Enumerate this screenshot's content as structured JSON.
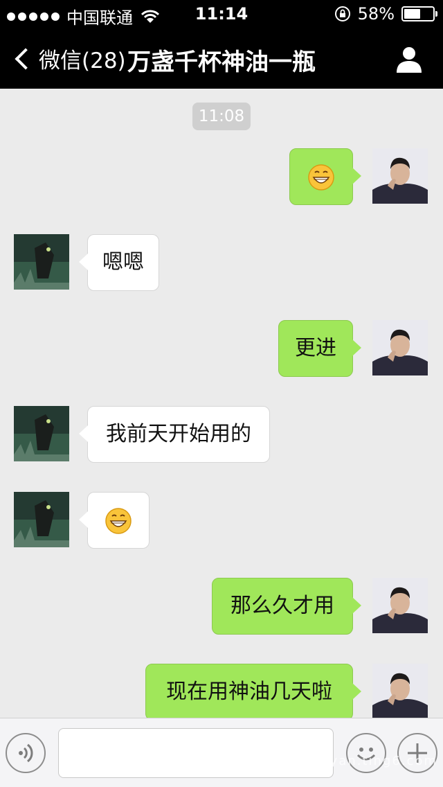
{
  "status_bar": {
    "carrier": "中国联通",
    "time": "11:14",
    "battery_text": "58%",
    "battery_level": 0.58,
    "icons": [
      "signal-dots-icon",
      "wifi-icon",
      "orientation-lock-icon",
      "battery-icon"
    ]
  },
  "nav": {
    "back_label": "微信(28)",
    "title": "万盏千杯神油一瓶",
    "right_icon": "person-icon"
  },
  "chat": {
    "timestamp": "11:08",
    "messages": [
      {
        "from": "me",
        "type": "emoji",
        "text": "",
        "icon": "grinning-face-emoji"
      },
      {
        "from": "them",
        "type": "text",
        "text": "嗯嗯"
      },
      {
        "from": "me",
        "type": "text",
        "text": "更进"
      },
      {
        "from": "them",
        "type": "text",
        "text": "我前天开始用的"
      },
      {
        "from": "them",
        "type": "emoji",
        "text": "",
        "icon": "grinning-face-emoji"
      },
      {
        "from": "me",
        "type": "text",
        "text": "那么久才用"
      },
      {
        "from": "me",
        "type": "text",
        "text": "现在用神油几天啦"
      }
    ]
  },
  "input_bar": {
    "voice_icon": "voice-icon",
    "input_value": "",
    "emoji_icon": "smiley-icon",
    "plus_icon": "plus-icon"
  },
  "colors": {
    "nav_bg": "#000000",
    "chat_bg": "#ebebeb",
    "my_bubble": "#a0e75a",
    "their_bubble": "#ffffff"
  },
  "watermark": "jingyan.ting6.com"
}
